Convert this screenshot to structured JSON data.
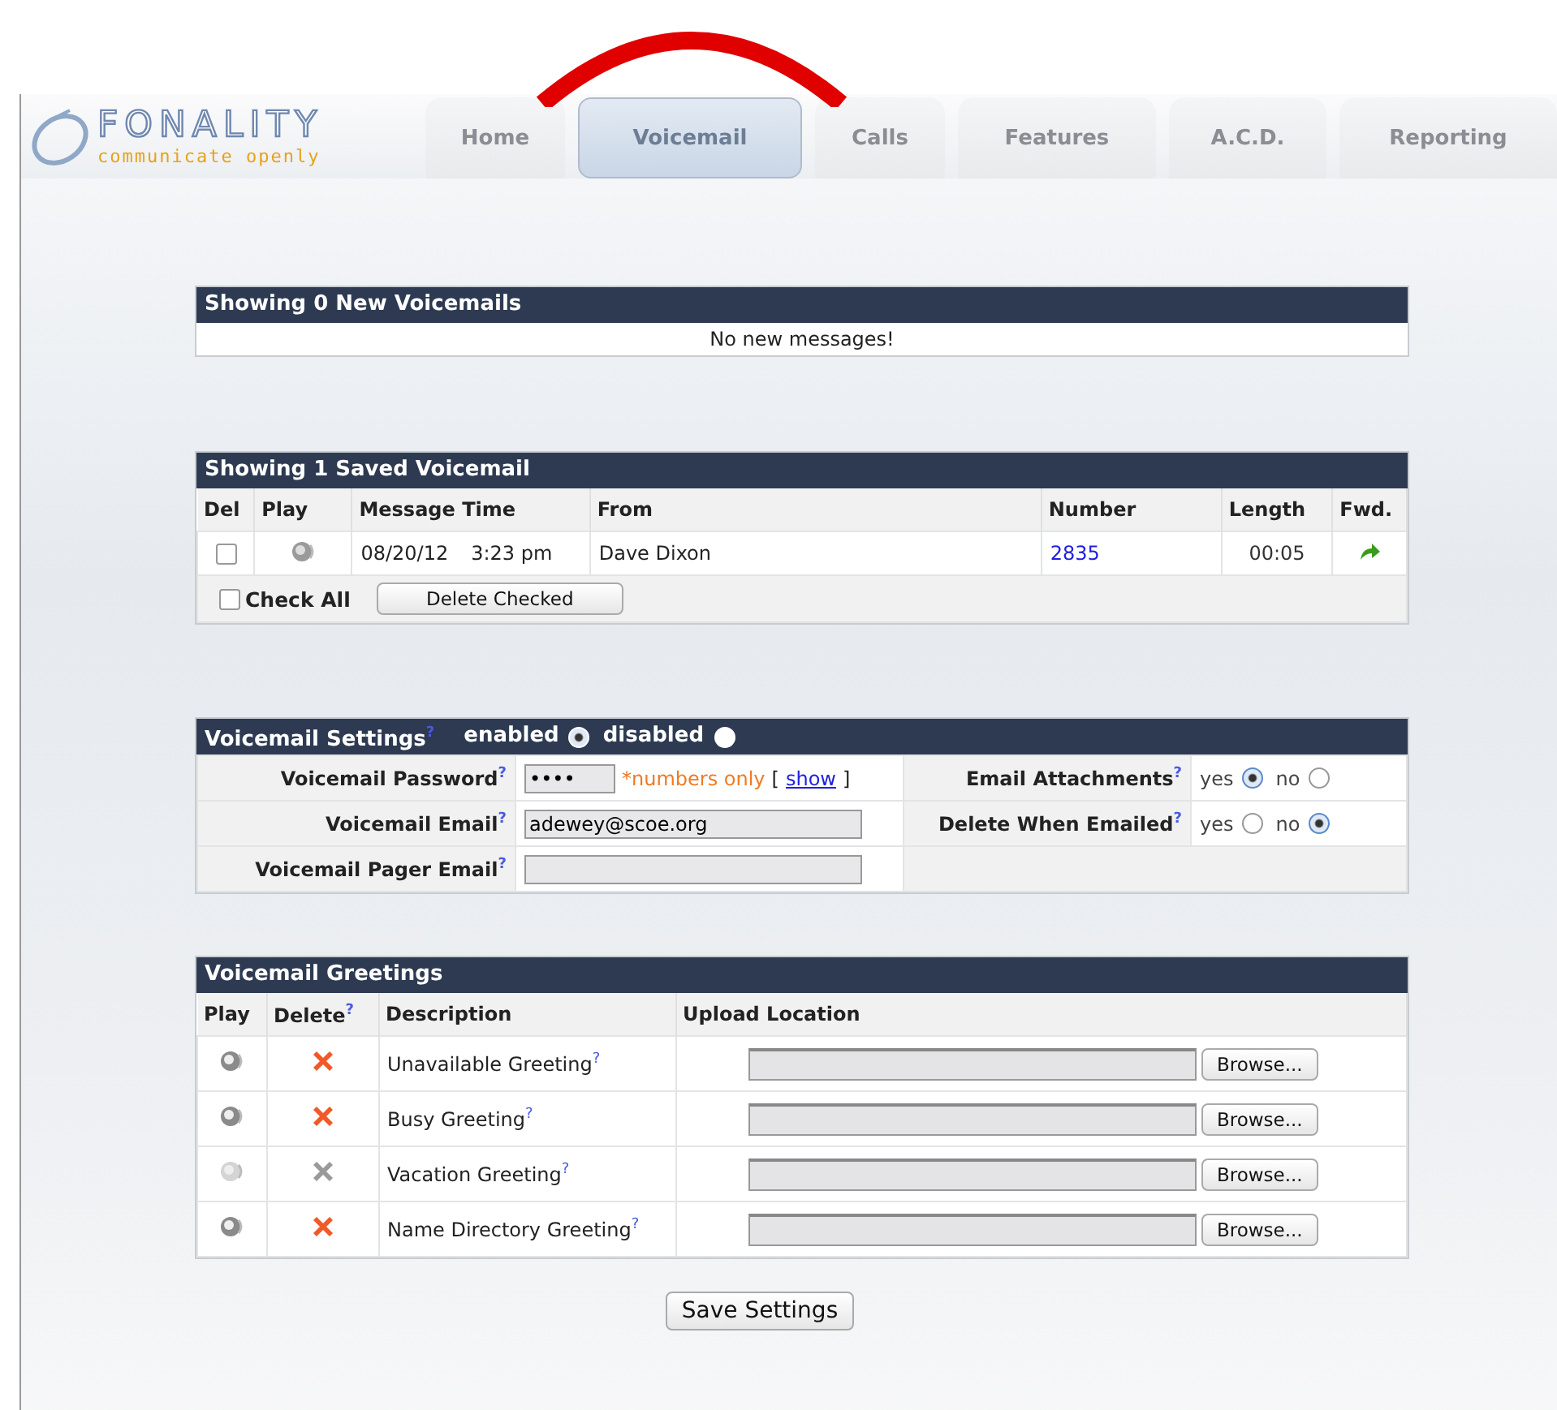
{
  "logo": {
    "name": "FONALITY",
    "tagline": "communicate openly"
  },
  "tabs": [
    {
      "label": "Home",
      "selected": false
    },
    {
      "label": "Voicemail",
      "selected": true
    },
    {
      "label": "Calls",
      "selected": false
    },
    {
      "label": "Features",
      "selected": false
    },
    {
      "label": "A.C.D.",
      "selected": false
    },
    {
      "label": "Reporting",
      "selected": false
    }
  ],
  "new_voicemails": {
    "title": "Showing 0 New Voicemails",
    "message": "No new messages!"
  },
  "saved_voicemails": {
    "title": "Showing 1 Saved Voicemail",
    "columns": [
      "Del",
      "Play",
      "Message Time",
      "From",
      "Number",
      "Length",
      "Fwd."
    ],
    "rows": [
      {
        "checked": false,
        "date": "08/20/12",
        "time": "3:23 pm",
        "from": "Dave Dixon",
        "number": "2835",
        "length": "00:05"
      }
    ],
    "check_all": {
      "label": "Check All",
      "checked": false
    },
    "delete_button": "Delete Checked"
  },
  "settings": {
    "title": "Voicemail Settings$^{?}$",
    "modes": [
      {
        "label": "enabled",
        "selected": true
      },
      {
        "label": "disabled",
        "selected": false
      }
    ],
    "fields": [
      {
        "label": "Voicemail Password$^{?}$",
        "value": "••••",
        "hint": "*numbers only",
        "link_open": "[",
        "link": "show",
        "link_close": "]"
      },
      {
        "label": "Voicemail Email$^{?}$",
        "value": "adewey@scoe.org"
      },
      {
        "label": "Voicemail Pager Email$^{?}$"
      }
    ],
    "toggles": [
      {
        "label": "Email Attachments$^{?}$",
        "options": [
          {
            "label": "yes",
            "selected": true
          },
          {
            "label": "no",
            "selected": false
          }
        ]
      },
      {
        "label": "Delete When Emailed$^{?}$",
        "options": [
          {
            "label": "yes",
            "selected": false
          },
          {
            "label": "no",
            "selected": true
          }
        ]
      }
    ]
  },
  "greetings": {
    "title": "Voicemail Greetings",
    "columns": [
      "Play",
      "Delete$^{?}$",
      "Description",
      "Upload Location"
    ],
    "rows": [
      {
        "description": "Unavailable Greeting$^{?}$",
        "disabled": false,
        "browse": "Browse..."
      },
      {
        "description": "Busy Greeting$^{?}$",
        "disabled": false,
        "browse": "Browse..."
      },
      {
        "description": "Vacation Greeting$^{?}$",
        "disabled": true,
        "browse": "Browse..."
      },
      {
        "description": "Name Directory Greeting$^{?}$",
        "disabled": false,
        "browse": "Browse..."
      }
    ]
  },
  "save_button": "Save Settings"
}
